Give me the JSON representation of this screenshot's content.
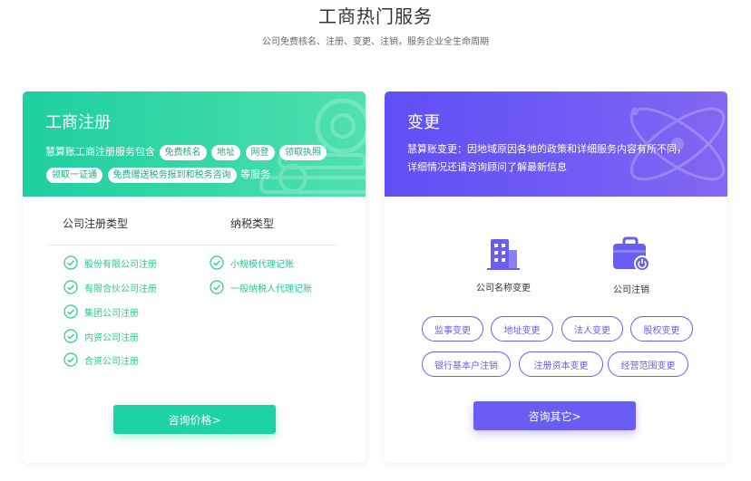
{
  "header": {
    "title": "工商热门服务",
    "subtitle": "公司免费核名、注册、变更、注销，服务企业全生命周期"
  },
  "left_card": {
    "title": "工商注册",
    "intro_prefix": "慧算账工商注册服务包含",
    "intro_suffix": "等服务",
    "tags_line1": [
      "免费核名",
      "地址",
      "网登",
      "领取执照"
    ],
    "tags_line2": [
      "领取一证通",
      "免费赠送税务报到和税务咨询"
    ],
    "col1_heading": "公司注册类型",
    "col2_heading": "纳税类型",
    "col1_items": [
      "股份有限公司注册",
      "有限合伙公司注册",
      "集团公司注册",
      "内资公司注册",
      "合资公司注册"
    ],
    "col2_items": [
      "小规模代理记账",
      "一般纳税人代理记账"
    ],
    "button_label": "咨询价格>",
    "accent_color": "#1ed3a3"
  },
  "right_card": {
    "title": "变更",
    "desc_line1": "慧算账变更：因地域原因各地的政策和详细服务内容有所不同，",
    "desc_line2": "详细情况还请咨询顾问了解最新信息",
    "service1_label": "公司名称变更",
    "service1_icon": "building-icon",
    "service2_label": "公司注销",
    "service2_icon": "briefcase-power-icon",
    "tags_row1": [
      "监事变更",
      "地址变更",
      "法人变更",
      "股权变更"
    ],
    "tags_row2": [
      "银行基本户注销",
      "注册资本变更",
      "经营范围变更"
    ],
    "button_label": "咨询其它>",
    "accent_color": "#6a5df3"
  }
}
